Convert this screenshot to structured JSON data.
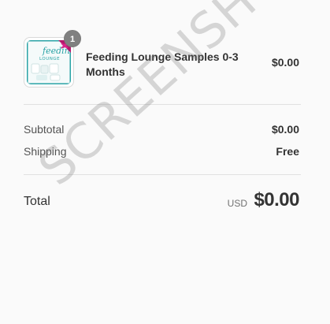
{
  "line_item": {
    "quantity": "1",
    "name": "Feeding Lounge Samples 0-3 Months",
    "price": "$0.00",
    "thumbnail_text": "feeding LOUNGE",
    "thumbnail_icon": "product-thumbnail"
  },
  "subtotal": {
    "label": "Subtotal",
    "value": "$0.00"
  },
  "shipping": {
    "label": "Shipping",
    "value": "Free"
  },
  "total": {
    "label": "Total",
    "currency": "USD",
    "amount": "$0.00"
  },
  "watermark": "SCREENSHOT",
  "colors": {
    "accent_teal": "#2aa3a6",
    "ribbon_pink": "#b5176b",
    "badge_gray": "#808080"
  }
}
